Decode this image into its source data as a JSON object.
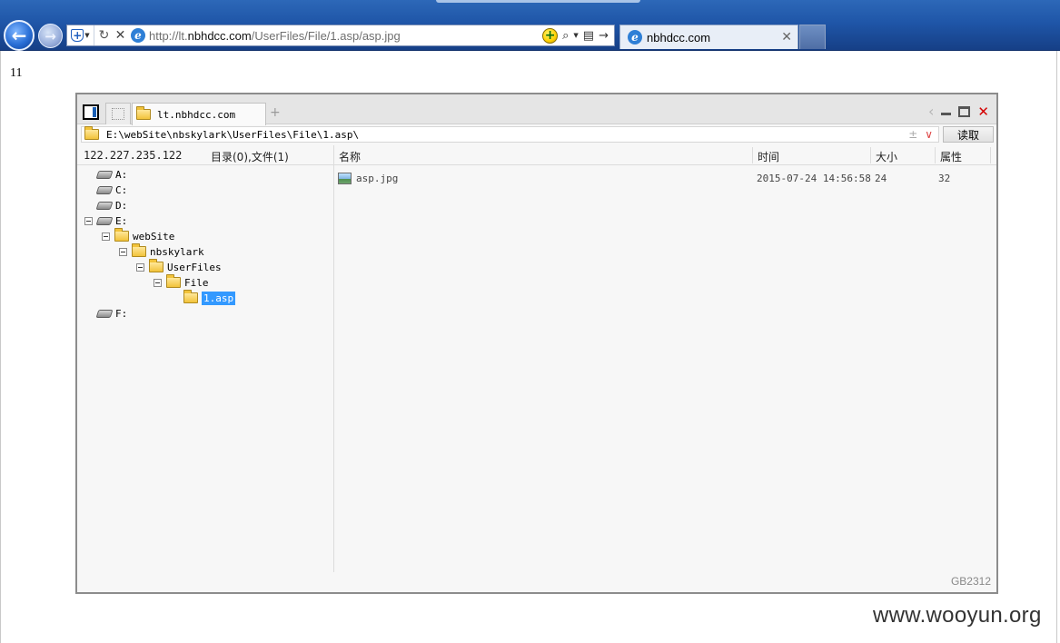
{
  "browser": {
    "url_prefix": "http://lt.",
    "url_domain": "nbhdcc.com",
    "url_path": "/UserFiles/File/1.asp/asp.jpg",
    "tab_title": "nbhdcc.com",
    "icons": [
      "back-arrow-icon",
      "forward-arrow-icon",
      "shield-icon",
      "refresh-icon",
      "stop-icon",
      "ie-logo-icon",
      "add-on-icon",
      "search-icon",
      "compatibility-icon",
      "go-arrow-icon",
      "close-icon"
    ]
  },
  "page": {
    "text": "11"
  },
  "filemanager": {
    "tab_label": "lt.nbhdcc.com",
    "add_tab": "+",
    "path": "E:\\webSite\\nbskylark\\UserFiles\\File\\1.asp\\",
    "read_button": "读取",
    "ip": "122.227.235.122",
    "summary": "目录(0),文件(1)",
    "columns": {
      "name": "名称",
      "time": "时间",
      "size": "大小",
      "attr": "属性"
    },
    "tree": {
      "drive_a": "A:",
      "drive_c": "C:",
      "drive_d": "D:",
      "drive_e": "E:",
      "folder_website": "webSite",
      "folder_nbskylark": "nbskylark",
      "folder_userfiles": "UserFiles",
      "folder_file": "File",
      "folder_1asp": "1.asp",
      "drive_f": "F:"
    },
    "files": [
      {
        "name": "asp.jpg",
        "time": "2015-07-24 14:56:58",
        "size": "24",
        "attr": "32"
      }
    ],
    "encoding": "GB2312"
  },
  "watermark": "www.wooyun.org",
  "colors": {
    "selection": "#3399ff",
    "ie_frame": "#1f56a8",
    "close": "#d40000"
  }
}
